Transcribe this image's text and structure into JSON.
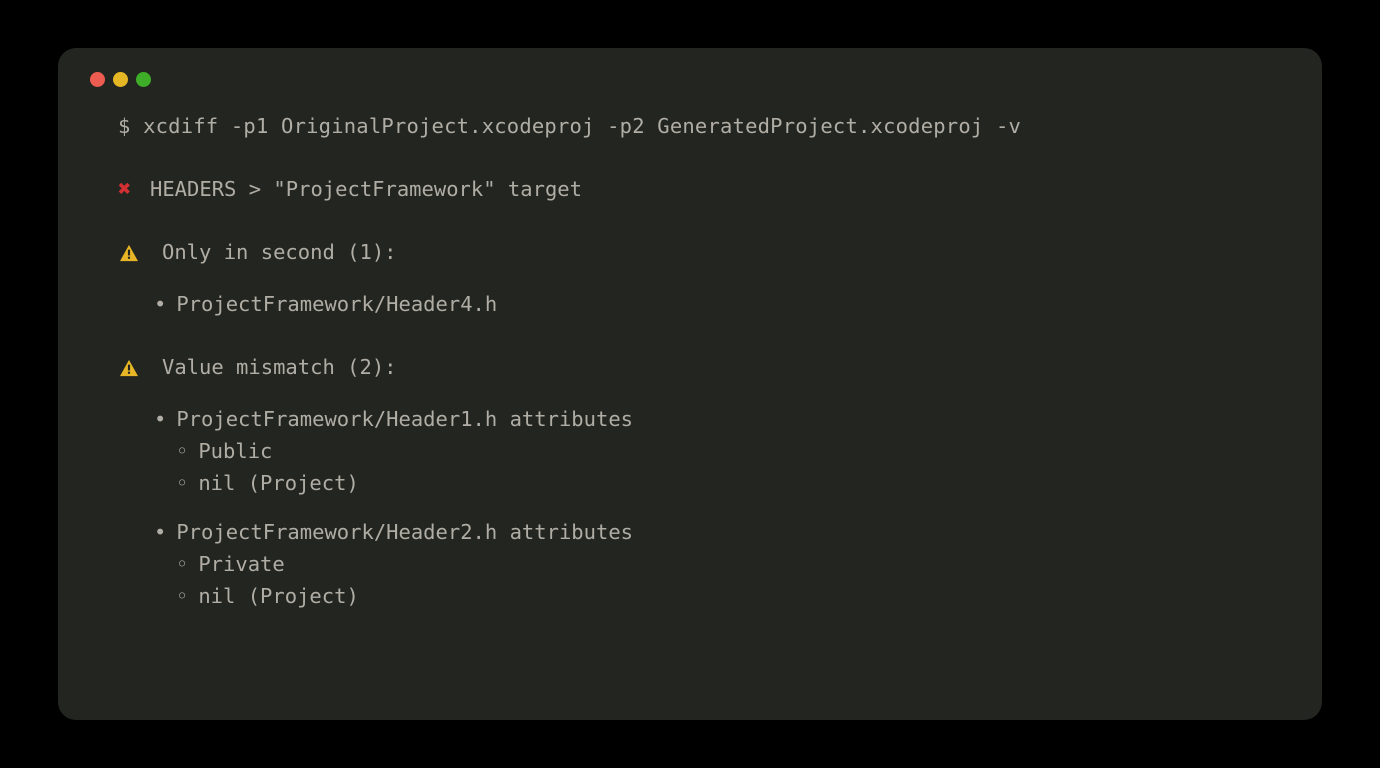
{
  "command": "$ xcdiff -p1 OriginalProject.xcodeproj -p2 GeneratedProject.xcodeproj -v",
  "section": {
    "header": "HEADERS > \"ProjectFramework\" target"
  },
  "onlyInSecond": {
    "label": "Only in second (1):",
    "items": [
      "ProjectFramework/Header4.h"
    ]
  },
  "valueMismatch": {
    "label": "Value mismatch (2):",
    "items": [
      {
        "path": "ProjectFramework/Header1.h attributes",
        "details": [
          "Public",
          "nil (Project)"
        ]
      },
      {
        "path": "ProjectFramework/Header2.h attributes",
        "details": [
          "Private",
          "nil (Project)"
        ]
      }
    ]
  }
}
